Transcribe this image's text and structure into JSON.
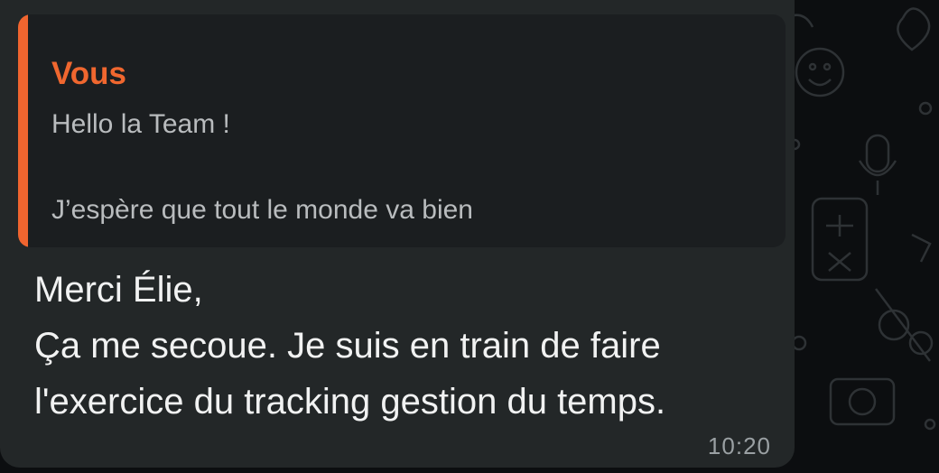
{
  "reply_quote": {
    "author": "Vous",
    "line1": "Hello la Team !",
    "line2": "J’espère que tout le monde va bien",
    "accent_color": "#f0652f"
  },
  "message": {
    "line1": "Merci Élie,",
    "line2": "Ça me secoue.  Je suis en train de faire",
    "line3": "l'exercice du tracking gestion du temps.",
    "time": "10:20"
  },
  "background": {
    "pattern_icons": [
      "smiley-icon",
      "microphone-icon",
      "calculator-icon",
      "scissors-icon",
      "camera-icon",
      "heart-icon"
    ]
  }
}
